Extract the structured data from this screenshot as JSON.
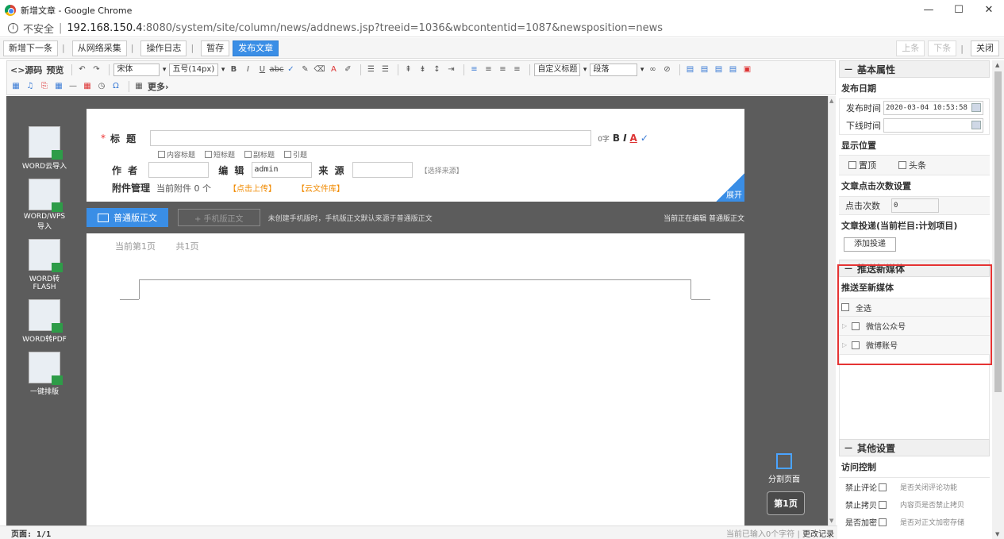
{
  "window": {
    "title": "新增文章 - Google Chrome",
    "controls": [
      "—",
      "☐",
      "✕"
    ]
  },
  "address": {
    "security_label": "不安全",
    "url_host": "192.168.150.4",
    "url_path": ":8080/system/site/column/news/addnews.jsp?treeid=1036&wbcontentid=1087&newsposition=news"
  },
  "page_toolbar": {
    "add_next": "新增下一条",
    "web_collect": "从网络采集",
    "op_log": "操作日志",
    "save_draft": "暂存",
    "publish": "发布文章",
    "prev": "上条",
    "next": "下条",
    "close": "关闭"
  },
  "editor_toolbar": {
    "source": "<>源码",
    "preview": "预览",
    "font_family": "宋体",
    "font_size": "五号(14px)",
    "custom_heading": "自定义标题",
    "paragraph": "段落",
    "more": "更多›"
  },
  "left_tools": [
    {
      "label": "WORD云导入"
    },
    {
      "label": "WORD/WPS导入"
    },
    {
      "label": "WORD转FLASH"
    },
    {
      "label": "WORD转PDF"
    },
    {
      "label": "一键排版"
    }
  ],
  "doc_header": {
    "title_label": "标    题",
    "char_count": "0字",
    "sub_options": [
      "内容标题",
      "短标题",
      "副标题",
      "引题"
    ],
    "author_label": "作    者",
    "editor_label": "编  辑",
    "editor_value": "admin",
    "source_label": "来  源",
    "choose_source": "【选择来源】",
    "attach_label": "附件管理",
    "attach_count": "当前附件 0 个",
    "upload_link": "【点击上传】",
    "cloud_link": "【云文件库】",
    "expand": "展开"
  },
  "body_tabs": {
    "normal": "普通版正文",
    "mobile": "+ 手机版正文",
    "note": "未创建手机版时，手机版正文默认来源于普通版正文",
    "status": "当前正在编辑  普通版正文"
  },
  "doc_page": {
    "current_page": "当前第1页",
    "total_pages": "共1页"
  },
  "split_page": "分割页面",
  "page_badge": "第1页",
  "status_bar": {
    "page": "页面:  1/1",
    "chars": "当前已输入0个字符",
    "history": "更改记录"
  },
  "right_panel": {
    "basic_title": "基本属性",
    "publish_date_label": "发布日期",
    "publish_time_label": "发布时间",
    "publish_time_value": "2020-03-04 10:53:58",
    "offline_time_label": "下线时间",
    "display_pos_label": "显示位置",
    "pin_top": "置顶",
    "headline": "头条",
    "click_setting_label": "文章点击次数设置",
    "click_count_label": "点击次数",
    "click_count_value": "0",
    "delivery_label": "文章投递(当前栏目:计划项目)",
    "add_delivery": "添加投递",
    "push_title": "推送新媒体",
    "push_to_label": "推送至新媒体",
    "select_all": "全选",
    "wechat": "微信公众号",
    "weibo": "微博账号",
    "other_title": "其他设置",
    "access_label": "访问控制",
    "access_rows": [
      {
        "label": "禁止评论",
        "desc": "是否关闭评论功能"
      },
      {
        "label": "禁止拷贝",
        "desc": "内容页是否禁止拷贝"
      },
      {
        "label": "是否加密",
        "desc": "是否对正文加密存储"
      }
    ]
  }
}
